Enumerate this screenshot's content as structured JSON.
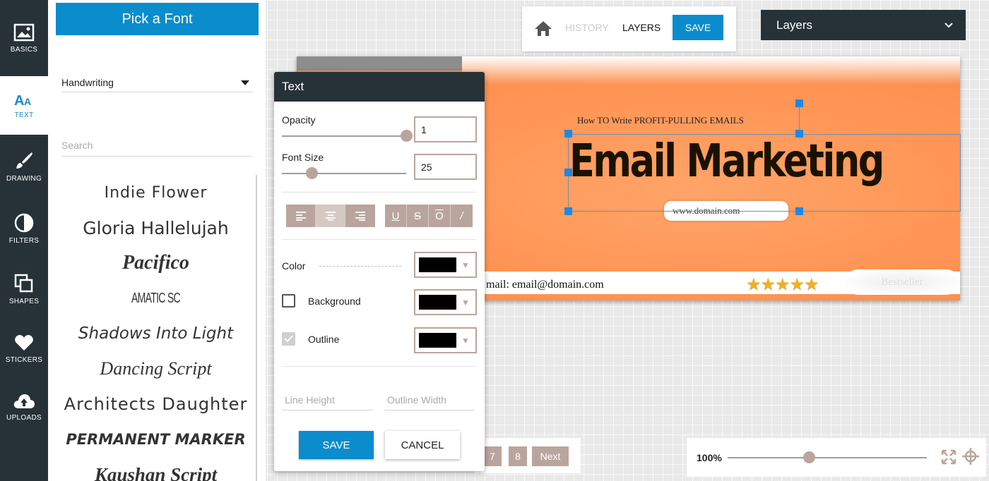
{
  "sidebar": {
    "items": [
      {
        "label": "BASICS",
        "icon": "image-icon"
      },
      {
        "label": "TEXT",
        "icon": "text-icon",
        "active": true
      },
      {
        "label": "DRAWING",
        "icon": "brush-icon"
      },
      {
        "label": "FILTERS",
        "icon": "filter-icon"
      },
      {
        "label": "SHAPES",
        "icon": "shapes-icon"
      },
      {
        "label": "STICKERS",
        "icon": "heart-icon"
      },
      {
        "label": "UPLOADS",
        "icon": "cloud-upload-icon"
      }
    ]
  },
  "font_panel": {
    "title": "Pick a Font",
    "category": "Handwriting",
    "search_placeholder": "Search",
    "fonts": [
      "Indie Flower",
      "Gloria Hallelujah",
      "Pacifico",
      "AMATIC SC",
      "Shadows Into Light",
      "Dancing Script",
      "Architects Daughter",
      "Permanent Marker",
      "Kaushan Script"
    ]
  },
  "text_dialog": {
    "title": "Text",
    "opacity_label": "Opacity",
    "opacity_value": "1",
    "opacity_fraction": 1.0,
    "font_size_label": "Font Size",
    "font_size_value": "25",
    "align_buttons": [
      "left",
      "center",
      "right"
    ],
    "format_buttons": [
      "U",
      "S",
      "O",
      "/"
    ],
    "color_label": "Color",
    "background_label": "Background",
    "outline_label": "Outline",
    "background_checked": false,
    "outline_checked": true,
    "swatch_color": "#000000",
    "line_height_placeholder": "Line Height",
    "outline_width_placeholder": "Outline Width",
    "save_label": "SAVE",
    "cancel_label": "CANCEL"
  },
  "toolbar": {
    "history_label": "HISTORY",
    "layers_label": "LAYERS",
    "save_label": "SAVE"
  },
  "layers_dropdown": {
    "label": "Layers"
  },
  "design": {
    "subtitle": "How TO Write PROFIT-PULLING EMAILS",
    "title": "Email Marketing",
    "domain": "www.domain.com",
    "email": "mail: email@domain.com",
    "stars": "★★★★★",
    "badge": "Bestseller"
  },
  "pager": {
    "pages": [
      "7",
      "8"
    ],
    "next_label": "Next"
  },
  "zoom": {
    "label": "100%",
    "level_fraction": 0.4
  },
  "colors": {
    "accent": "#0a8ccd",
    "dark": "#263238",
    "button_tan": "#b9a59d",
    "design_orange": "#ff9454"
  }
}
